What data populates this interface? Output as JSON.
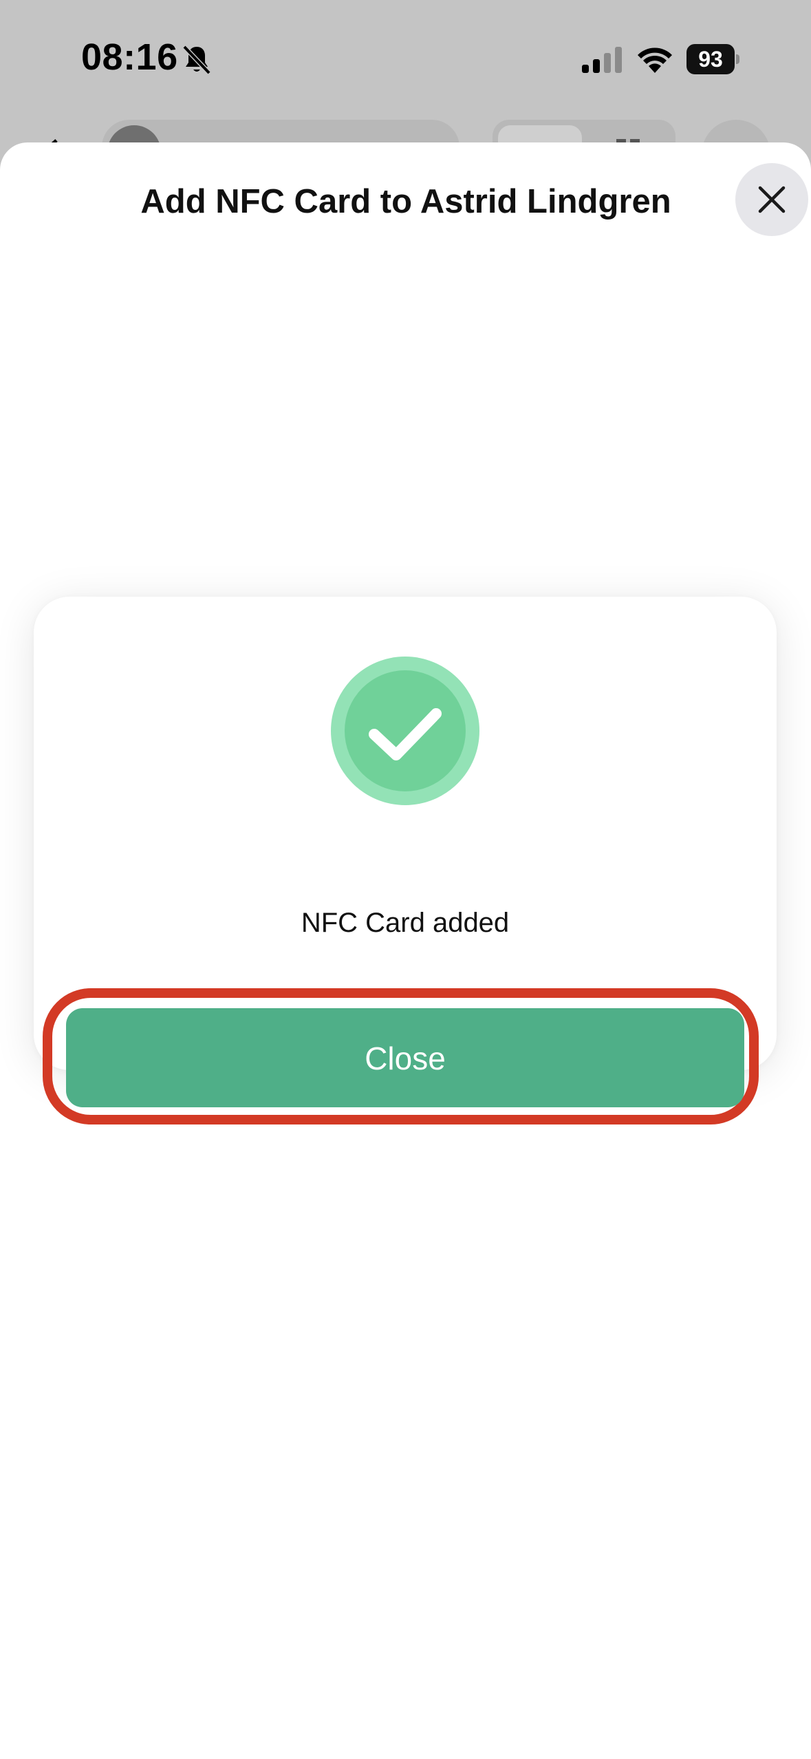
{
  "status_bar": {
    "time": "08:16",
    "battery": "93"
  },
  "sheet": {
    "title": "Add NFC Card to Astrid Lindgren",
    "close_icon": "close-x-icon"
  },
  "success_card": {
    "icon": "checkmark-circle-icon",
    "message": "NFC Card added",
    "close_label": "Close",
    "accent_color": "#4faf88",
    "highlight_color": "#d33a25"
  }
}
